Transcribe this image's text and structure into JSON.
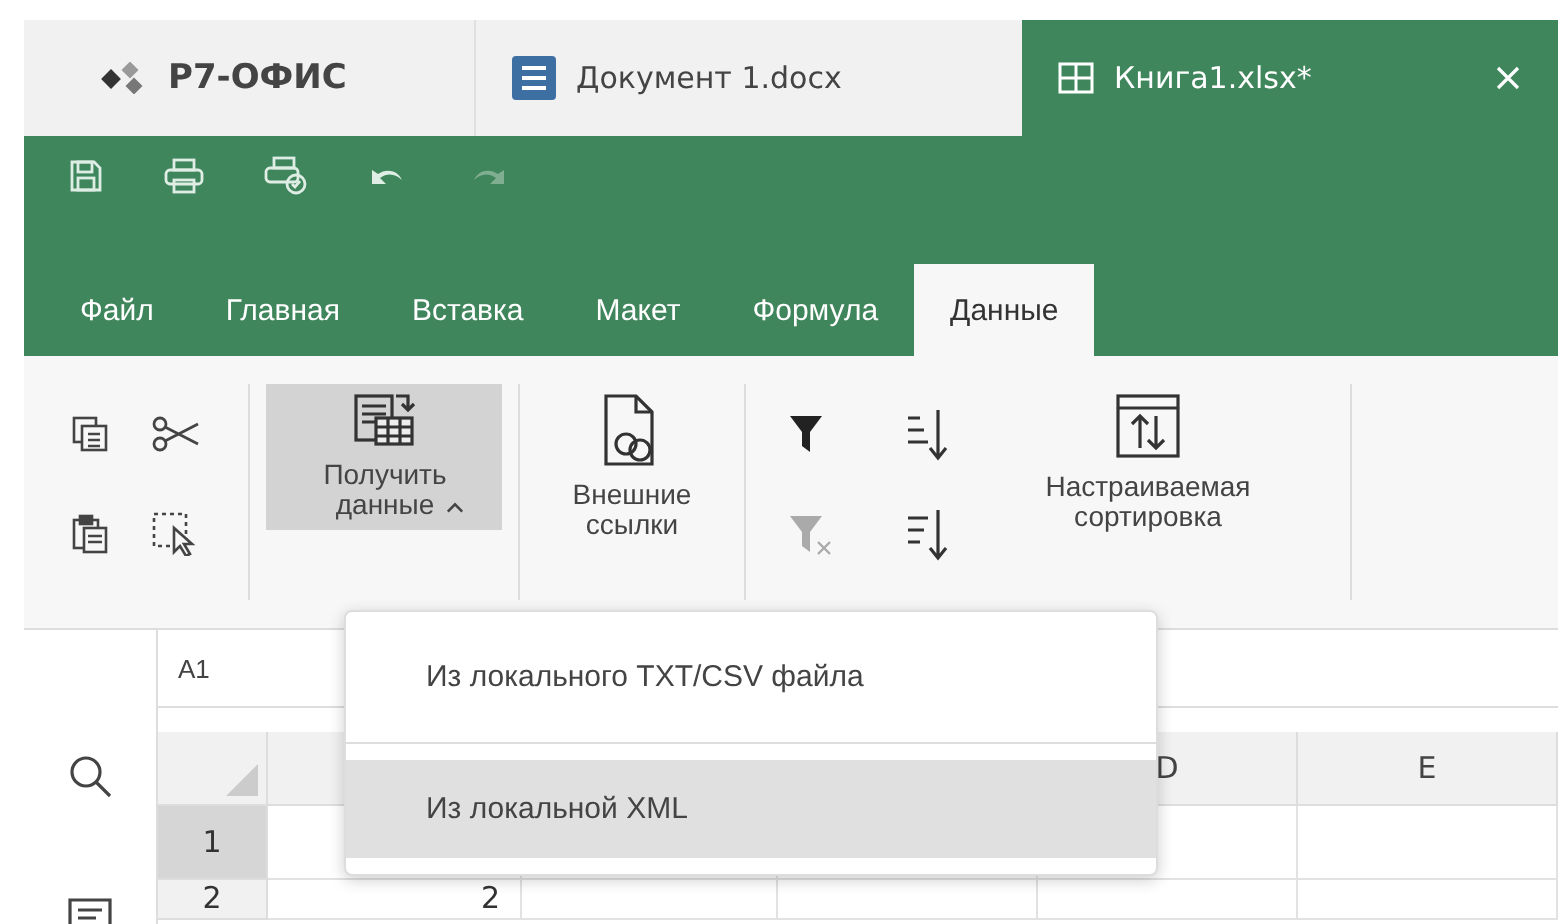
{
  "app_tabs": [
    {
      "kind": "logo",
      "label": "Р7-ОФИС",
      "selected": false
    },
    {
      "kind": "document",
      "label": "Документ 1.docx",
      "selected": false
    },
    {
      "kind": "spreadsheet",
      "label": "Книга1.xlsx*",
      "selected": true
    }
  ],
  "menu_tabs": [
    {
      "label": "Файл",
      "selected": false
    },
    {
      "label": "Главная",
      "selected": false
    },
    {
      "label": "Вставка",
      "selected": false
    },
    {
      "label": "Макет",
      "selected": false
    },
    {
      "label": "Формула",
      "selected": false
    },
    {
      "label": "Данные",
      "selected": true
    }
  ],
  "ribbon": {
    "get_data": {
      "label": "Получить данные",
      "expanded": true
    },
    "external_links": "Внешние ссылки",
    "custom_sort": "Настраиваемая сортировка"
  },
  "cell_name": "A1",
  "columns": [
    {
      "label": "D"
    },
    {
      "label": "E"
    }
  ],
  "rows": [
    {
      "header": "1",
      "cells": [
        "",
        "",
        "",
        "",
        ""
      ]
    },
    {
      "header": "2",
      "cells": [
        "2",
        "",
        "",
        "",
        ""
      ]
    }
  ],
  "dropdown": {
    "items": [
      {
        "label": "Из локального TXT/CSV файла",
        "selected": false
      },
      {
        "label": "Из локальной XML",
        "selected": true
      }
    ]
  }
}
